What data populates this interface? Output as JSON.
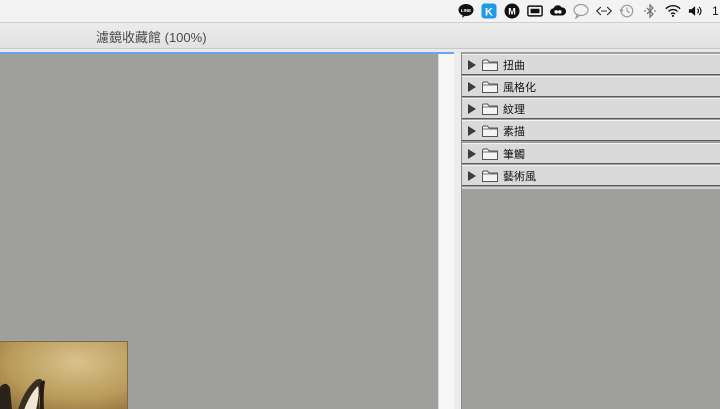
{
  "menubar": {
    "status_icons": [
      "line-icon",
      "kk-icon",
      "m-icon",
      "screen-icon",
      "creative-cloud-icon",
      "chat-bubble-icon",
      "code-arrows-icon",
      "time-machine-icon",
      "bluetooth-icon",
      "wifi-icon",
      "volume-icon"
    ],
    "clock_partial": "1"
  },
  "window": {
    "title": "濾鏡收藏館 (100%)"
  },
  "filter_panel": {
    "folders": [
      {
        "label": "扭曲"
      },
      {
        "label": "風格化"
      },
      {
        "label": "紋理"
      },
      {
        "label": "素描"
      },
      {
        "label": "筆觸"
      },
      {
        "label": "藝術風"
      }
    ]
  },
  "colors": {
    "accent": "#65a6ee",
    "canvas": "#9f9f9e",
    "row": "#dadada"
  }
}
